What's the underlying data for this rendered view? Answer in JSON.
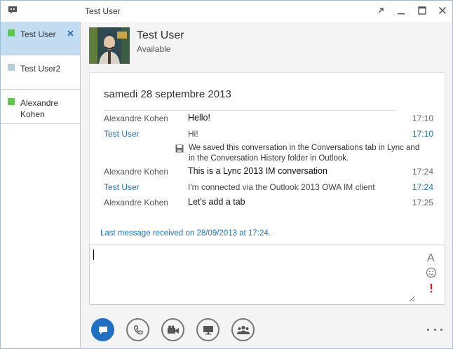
{
  "window": {
    "title": "Test User"
  },
  "sidebar": {
    "items": [
      {
        "label": "Test User",
        "status_color": "#5cc94a",
        "active": true
      },
      {
        "label": "Test User2",
        "status_color": "#b5cfe0",
        "active": false
      },
      {
        "label": "Alexandre Kohen",
        "status_color": "#5cc94a",
        "active": false
      }
    ]
  },
  "contact": {
    "name": "Test User",
    "status": "Available"
  },
  "conversation": {
    "date": "samedi 28 septembre 2013",
    "messages": [
      {
        "sender": "Alexandre Kohen",
        "text": "Hello!",
        "time": "17:10",
        "self": false
      },
      {
        "sender": "Test User",
        "text": "Hi!",
        "time": "17:10",
        "self": true
      },
      {
        "sender": "Alexandre Kohen",
        "text": "This is a Lync 2013 IM conversation",
        "time": "17:24",
        "self": false
      },
      {
        "sender": "Test User",
        "text": "I'm connected via the Outlook 2013 OWA IM client",
        "time": "17:24",
        "self": true
      },
      {
        "sender": "Alexandre Kohen",
        "text": "Let's add a tab",
        "time": "17:25",
        "self": false
      }
    ],
    "save_notice": "We saved this conversation in the Conversations tab in Lync and in the Conversation History folder in Outlook.",
    "last_received": "Last message received on 28/09/2013 at 17:24."
  },
  "compose": {
    "value": "",
    "tools": [
      "font-icon",
      "emoticon-icon",
      "importance-icon"
    ]
  },
  "modes": [
    "im-icon",
    "phone-icon",
    "video-icon",
    "present-icon",
    "participants-icon"
  ],
  "colors": {
    "accent": "#1f72b8",
    "active_item": "#c2dcf2",
    "available": "#5cc94a",
    "importance": "#e0201b"
  }
}
